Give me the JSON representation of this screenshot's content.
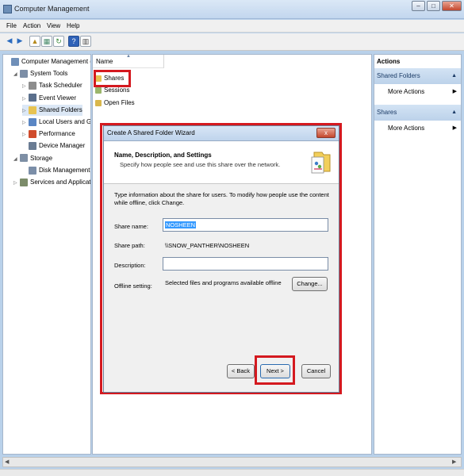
{
  "window": {
    "title": "Computer Management"
  },
  "menu": [
    "File",
    "Action",
    "View",
    "Help"
  ],
  "toolbar_icons": [
    "back-arrow-icon",
    "forward-arrow-icon",
    "up-folder-icon",
    "properties-icon",
    "refresh-icon",
    "help-icon",
    "show-hide-pane-icon"
  ],
  "tree": [
    {
      "label": "Computer Management (Local",
      "level": 0,
      "icon": "computer-management-icon",
      "color": "#6f8fb8",
      "arrow": ""
    },
    {
      "label": "System Tools",
      "level": 1,
      "icon": "system-tools-icon",
      "color": "#7c8ea6",
      "arrow": "◢"
    },
    {
      "label": "Task Scheduler",
      "level": 2,
      "icon": "clock-icon",
      "color": "#8d8d8d",
      "arrow": "▷"
    },
    {
      "label": "Event Viewer",
      "level": 2,
      "icon": "event-viewer-icon",
      "color": "#5a6f8c",
      "arrow": "▷"
    },
    {
      "label": "Shared Folders",
      "level": 2,
      "icon": "shared-folder-icon",
      "color": "#e7c352",
      "arrow": "▷"
    },
    {
      "label": "Local Users and Groups",
      "level": 2,
      "icon": "users-icon",
      "color": "#5a86c4",
      "arrow": "▷"
    },
    {
      "label": "Performance",
      "level": 2,
      "icon": "performance-icon",
      "color": "#d04b2b",
      "arrow": "▷"
    },
    {
      "label": "Device Manager",
      "level": 2,
      "icon": "device-manager-icon",
      "color": "#6a7c93",
      "arrow": ""
    },
    {
      "label": "Storage",
      "level": 1,
      "icon": "storage-icon",
      "color": "#7e8fa5",
      "arrow": "◢"
    },
    {
      "label": "Disk Management",
      "level": 2,
      "icon": "disk-icon",
      "color": "#7b8ea8",
      "arrow": ""
    },
    {
      "label": "Services and Applications",
      "level": 1,
      "icon": "services-icon",
      "color": "#7c8c6a",
      "arrow": "▷"
    }
  ],
  "center": {
    "column_name": "Name",
    "items": [
      {
        "label": "Shares",
        "icon": "shares-icon"
      },
      {
        "label": "Sessions",
        "icon": "sessions-icon"
      },
      {
        "label": "Open Files",
        "icon": "open-files-icon"
      }
    ]
  },
  "actions": {
    "title": "Actions",
    "sections": [
      {
        "label": "Shared Folders",
        "item": "More Actions"
      },
      {
        "label": "Shares",
        "item": "More Actions"
      }
    ]
  },
  "wizard": {
    "title": "Create A Shared Folder Wizard",
    "close": "x",
    "heading": "Name, Description, and Settings",
    "subheading": "Specify how people see and use this share over the network.",
    "intro": "Type information about the share for users. To modify how people use the content while offline, click Change.",
    "share_name_label": "Share name:",
    "share_name_value": "NOSHEEN",
    "share_path_label": "Share path:",
    "share_path_value": "\\\\SNOW_PANTHER\\NOSHEEN",
    "description_label": "Description:",
    "description_value": "",
    "offline_label": "Offline setting:",
    "offline_value": "Selected files and programs available offline",
    "change_button": "Change...",
    "back_button": "< Back",
    "next_button": "Next >",
    "cancel_button": "Cancel"
  },
  "colors": {
    "highlight": "#d4191f",
    "selection": "#3399ff",
    "panel_header": "#bcd2ea"
  }
}
